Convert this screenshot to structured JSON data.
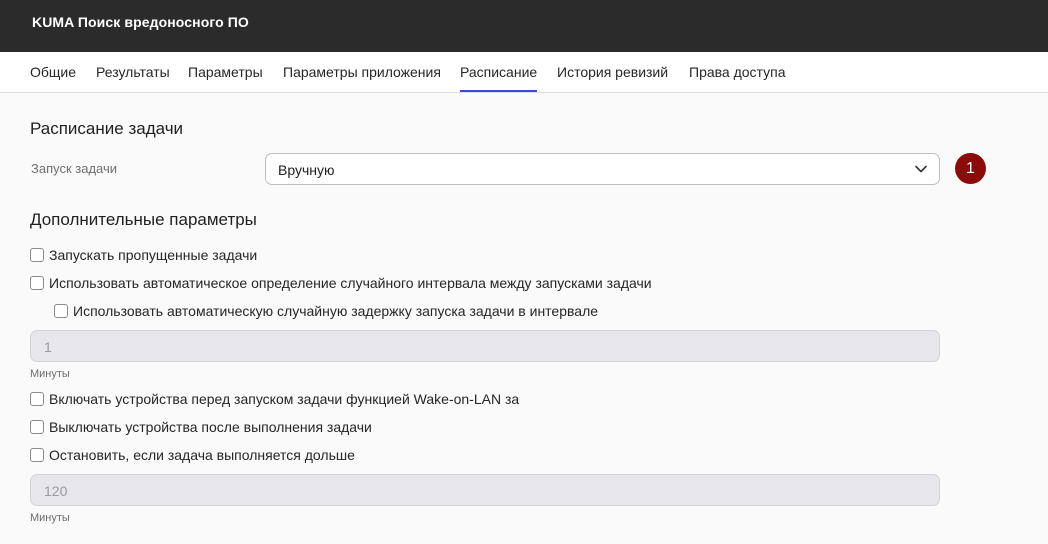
{
  "window": {
    "title": "KUMA Поиск вредоносного ПО"
  },
  "tabs": [
    {
      "label": "Общие",
      "active": false
    },
    {
      "label": "Результаты",
      "active": false
    },
    {
      "label": "Параметры",
      "active": false
    },
    {
      "label": "Параметры приложения",
      "active": false
    },
    {
      "label": "Расписание",
      "active": true
    },
    {
      "label": "История ревизий",
      "active": false
    },
    {
      "label": "Права доступа",
      "active": false
    }
  ],
  "schedule": {
    "title": "Расписание задачи",
    "run_label": "Запуск задачи",
    "run_value": "Вручную",
    "callout": "1"
  },
  "advanced": {
    "title": "Дополнительные параметры",
    "checkboxes": [
      {
        "label": "Запускать пропущенные задачи",
        "checked": false
      },
      {
        "label": "Использовать автоматическое определение случайного интервала между запусками задачи",
        "checked": false
      },
      {
        "label": "Использовать автоматическую случайную задержку запуска задачи в интервале",
        "checked": false
      },
      {
        "label": "Включать устройства перед запуском задачи функцией Wake-on-LAN за",
        "checked": false
      },
      {
        "label": "Выключать устройства после выполнения задачи",
        "checked": false
      },
      {
        "label": "Остановить, если задача выполняется дольше",
        "checked": false
      }
    ],
    "delay_value": "1",
    "delay_unit": "Минуты",
    "timeout_value": "120",
    "timeout_unit": "Минуты"
  },
  "colors": {
    "accent": "#3b4bd6",
    "titlebar": "#2b2b2b",
    "badge": "#8b0a0a"
  }
}
